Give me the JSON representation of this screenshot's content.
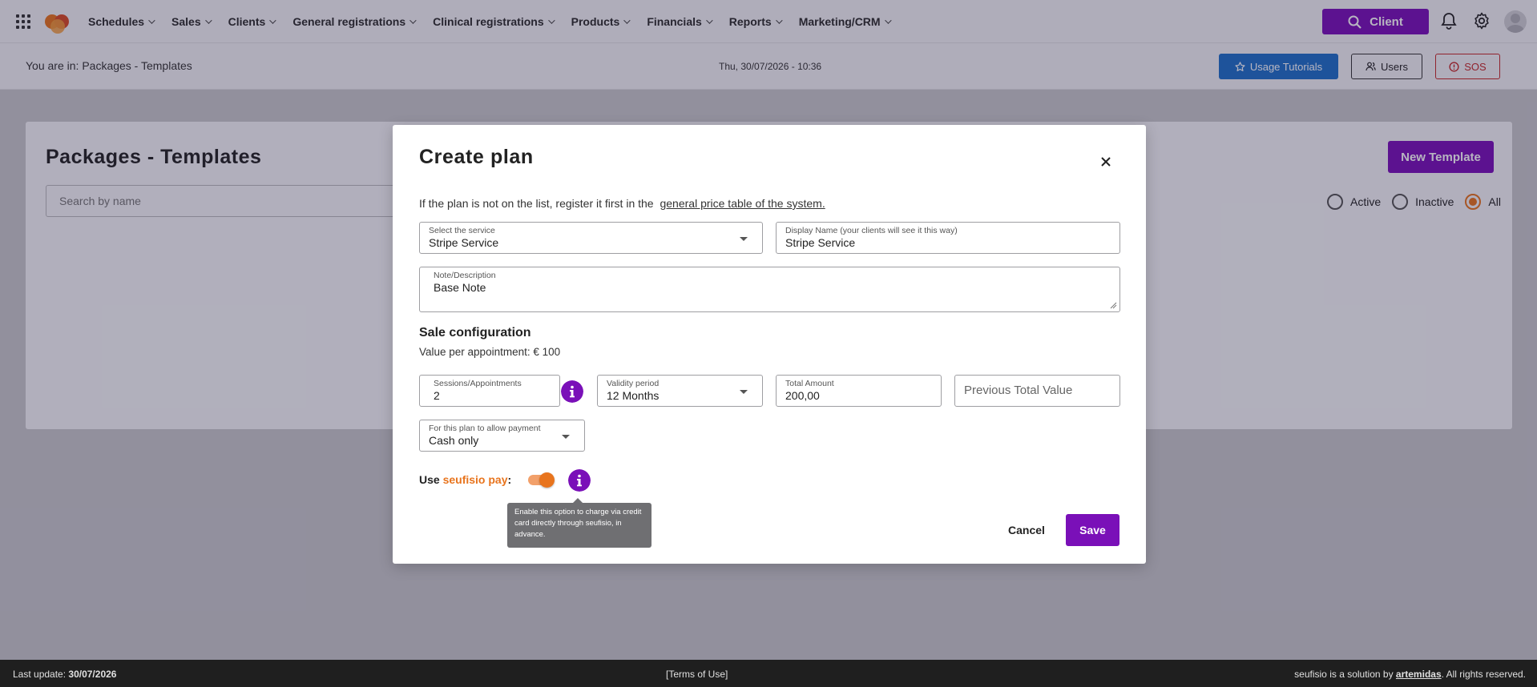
{
  "topnav": {
    "items": [
      {
        "label": "Schedules"
      },
      {
        "label": "Sales"
      },
      {
        "label": "Clients"
      },
      {
        "label": "General registrations"
      },
      {
        "label": "Clinical registrations"
      },
      {
        "label": "Products"
      },
      {
        "label": "Financials"
      },
      {
        "label": "Reports"
      },
      {
        "label": "Marketing/CRM"
      }
    ],
    "client_button": "Client"
  },
  "subbar": {
    "breadcrumb": "You are in: Packages - Templates",
    "datetime": "Thu, 30/07/2026 - 10:36",
    "tutorials_label": "Usage Tutorials",
    "users_label": "Users",
    "sos_label": "SOS"
  },
  "page": {
    "title": "Packages - Templates",
    "search_placeholder": "Search by name",
    "new_template_label": "New Template",
    "filters": [
      {
        "label": "Active",
        "checked": false
      },
      {
        "label": "Inactive",
        "checked": false
      },
      {
        "label": "All",
        "checked": true
      }
    ]
  },
  "modal": {
    "title": "Create plan",
    "intro_text": "If the plan is not on the list, register it first in the",
    "intro_link": "general price table of the system.",
    "service": {
      "label": "Select the service",
      "value": "Stripe Service"
    },
    "display_name": {
      "label": "Display Name (your clients will see it this way)",
      "value": "Stripe Service"
    },
    "note": {
      "label": "Note/Description",
      "value": "Base Note"
    },
    "sale_config_title": "Sale configuration",
    "value_per_appointment": "Value per appointment: € 100",
    "sessions": {
      "label": "Sessions/Appointments",
      "value": "2"
    },
    "validity": {
      "label": "Validity period",
      "value": "12 Months"
    },
    "total_amount": {
      "label": "Total Amount",
      "value": "200,00"
    },
    "previous_total_placeholder": "Previous Total Value",
    "payment": {
      "label": "For this plan to allow payment",
      "value": "Cash only"
    },
    "use_label": "Use",
    "brand_label": "seufisio pay",
    "use_suffix": ":",
    "seufisio_pay_enabled": true,
    "tooltip": "Enable this option to charge via credit card directly through seufisio, in advance.",
    "cancel_label": "Cancel",
    "save_label": "Save"
  },
  "footer": {
    "last_update_label": "Last update:",
    "last_update_value": "30/07/2026",
    "terms": "[Terms of Use]",
    "credit_prefix": "seufisio is a solution by",
    "credit_brand": "artemidas",
    "credit_suffix": ". All rights reserved."
  },
  "colors": {
    "primary": "#7a10b8",
    "accent": "#e8741d",
    "tutorial_blue": "#1e6fc9",
    "sos_red": "#c62828"
  }
}
